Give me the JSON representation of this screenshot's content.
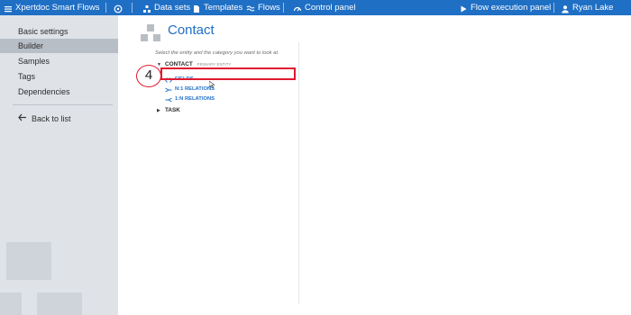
{
  "topbar": {
    "app_title": "Xpertdoc Smart Flows",
    "nav": [
      {
        "label": "Data sets",
        "icon": "data-sets-icon"
      },
      {
        "label": "Templates",
        "icon": "document-icon"
      },
      {
        "label": "Flows",
        "icon": "flows-icon"
      },
      {
        "label": "Control panel",
        "icon": "gauge-icon"
      }
    ],
    "flow_execution": "Flow execution panel",
    "user": "Ryan Lake"
  },
  "sidebar": {
    "items": [
      {
        "label": "Basic settings",
        "active": false
      },
      {
        "label": "Builder",
        "active": true
      },
      {
        "label": "Samples",
        "active": false
      },
      {
        "label": "Tags",
        "active": false
      },
      {
        "label": "Dependencies",
        "active": false
      }
    ],
    "back_label": "Back to list"
  },
  "main": {
    "title": "Contact",
    "hint": "Select the entity and the category you want to look at.",
    "tree": {
      "entity_contact": "CONTACT",
      "primary_badge": "PRIMARY ENTITY",
      "fields": "FIELDS",
      "n1_relations": "N:1 RELATIONS",
      "one_n_relations": "1:N RELATIONS",
      "entity_task": "TASK"
    },
    "step_number": "4"
  },
  "colors": {
    "accent": "#1f6fc5",
    "highlight": "#e0192f",
    "sidebar_bg": "#dfe3e8",
    "sidebar_active": "#b8bec6"
  }
}
